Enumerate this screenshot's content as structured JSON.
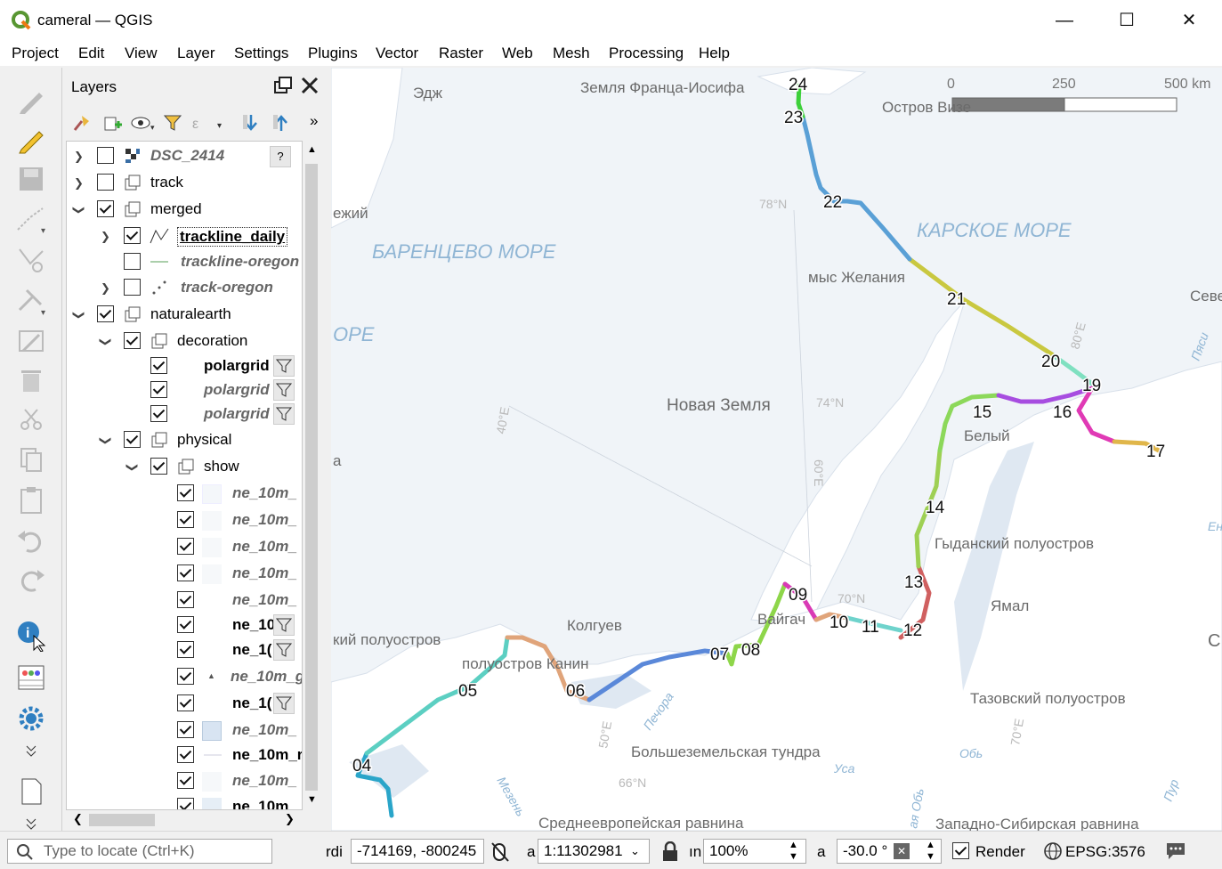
{
  "app": {
    "title": "cameral — QGIS",
    "minimize": "—",
    "maximize": "☐",
    "close": "✕"
  },
  "menu": [
    "Project",
    "Edit",
    "View",
    "Layer",
    "Settings",
    "Plugins",
    "Vector",
    "Raster",
    "Web",
    "Mesh",
    "Processing",
    "Help"
  ],
  "layers_panel": {
    "title": "Layers",
    "rows": [
      {
        "label": "DSC_2414",
        "italic": true
      },
      {
        "label": "track"
      },
      {
        "label": "merged"
      },
      {
        "label": "trackline_daily",
        "bold": true
      },
      {
        "label": "trackline-oregon",
        "italic": true
      },
      {
        "label": "track-oregon",
        "italic": true
      },
      {
        "label": "naturalearth"
      },
      {
        "label": "decoration"
      },
      {
        "label": "polargrid",
        "bold": true
      },
      {
        "label": "polargrid",
        "italic": true
      },
      {
        "label": "polargrid",
        "italic": true
      },
      {
        "label": "physical"
      },
      {
        "label": "show"
      },
      {
        "label": "ne_10m_",
        "italic": true
      },
      {
        "label": "ne_10m_",
        "italic": true
      },
      {
        "label": "ne_10m_",
        "italic": true
      },
      {
        "label": "ne_10m_",
        "italic": true
      },
      {
        "label": "ne_10m_",
        "italic": true
      },
      {
        "label": "ne_10",
        "bold": true
      },
      {
        "label": "ne_1(",
        "bold": true
      },
      {
        "label": "ne_10m_g",
        "italic": true
      },
      {
        "label": "ne_1(",
        "bold": true
      },
      {
        "label": "ne_10m_",
        "italic": true
      },
      {
        "label": "ne_10m_r",
        "bold": true
      },
      {
        "label": "ne_10m_",
        "italic": true
      },
      {
        "label": "ne_10m_",
        "bold": true
      }
    ]
  },
  "map": {
    "scalebar": {
      "t0": "0",
      "t1": "250",
      "t2": "500 km"
    },
    "labels": {
      "franz_josef": "Земля Франца-Иосифа",
      "vize": "Остров Визе",
      "edzh": "Эдж",
      "ezhiy": "ежий",
      "barents": "БАРЕНЦЕВО МОРЕ",
      "kara": "КАРСКОЕ МОРЕ",
      "zhelaniya": "мыс Желания",
      "seve": "Севе",
      "ore": "ОРЕ",
      "novaya": "Новая Земля",
      "beliy": "Белый",
      "a": "а",
      "gydan": "Гыданский полуостров",
      "yamal": "Ямал",
      "kolguev": "Колгуев",
      "vaygach": "Вайгач",
      "kiy": "кий полуостров",
      "kanin": "полуостров Канин",
      "taz": "Тазовский полуостров",
      "bolshezem": "Большеземельская тундра",
      "sredneevrop": "Среднеевропейская равнина",
      "zapsib": "Западно-Сибирская равнина",
      "c": "С",
      "pechora": "Печора",
      "mezen": "Мезень",
      "usa": "Уса",
      "ob": "Обь",
      "obsk": "ая Обь",
      "pur": "Пур",
      "pyasi": "Пяси",
      "en": "Ен",
      "lat78": "78°N",
      "lat74": "74°N",
      "lat70": "70°N",
      "lat66": "66°N",
      "lon80": "80°E",
      "lon40": "40°E",
      "lon60": "60°E",
      "lon50": "50°E",
      "lon70": "70°E"
    },
    "day_labels": [
      "04",
      "05",
      "06",
      "07",
      "08",
      "09",
      "10",
      "11",
      "12",
      "13",
      "14",
      "15",
      "16",
      "17",
      "19",
      "20",
      "21",
      "22",
      "23",
      "24"
    ]
  },
  "status": {
    "locate_placeholder": "Type to locate (Ctrl+K)",
    "coord_label": "rdi",
    "coordinate": "-714169, -800245",
    "scale_label": "a",
    "scale": "1:11302981",
    "magnifier_label": "ın",
    "magnifier": "100%",
    "rotation_label": "a",
    "rotation": "-30.0 °",
    "render": "Render",
    "crs": "EPSG:3576"
  }
}
